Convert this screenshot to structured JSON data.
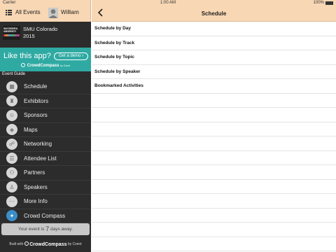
{
  "status_bar": {
    "carrier": "Carrier",
    "time": "1:00 AM",
    "battery": "100%"
  },
  "sidebar": {
    "all_events_label": "All Events",
    "username": "William",
    "event": {
      "logo_text": "SUCCESSFUL UNIVERSITY",
      "name_line1": "SMU Colorado",
      "name_line2": "2015"
    },
    "banner": {
      "headline": "Like this app?",
      "button": "Get a demo ›",
      "brand": "CrowdCompass",
      "brand_sub": "by Cvent"
    },
    "guide_label": "Event Guide",
    "items": [
      {
        "label": "Schedule",
        "icon": "calendar-icon"
      },
      {
        "label": "Exhibitors",
        "icon": "exhibitor-icon"
      },
      {
        "label": "Sponsors",
        "icon": "sponsor-icon"
      },
      {
        "label": "Maps",
        "icon": "map-icon"
      },
      {
        "label": "Networking",
        "icon": "networking-icon"
      },
      {
        "label": "Attendee List",
        "icon": "attendee-icon"
      },
      {
        "label": "Partners",
        "icon": "partners-icon"
      },
      {
        "label": "Speakers",
        "icon": "speaker-icon"
      },
      {
        "label": "More Info",
        "icon": "info-icon"
      },
      {
        "label": "Crowd Compass",
        "icon": "compass-icon"
      }
    ],
    "countdown": {
      "prefix": "Your event is",
      "days": "7",
      "suffix": "days away."
    },
    "built_with": {
      "prefix": "Built with",
      "brand": "CrowdCompass",
      "suffix": "by Cvent"
    }
  },
  "main": {
    "title": "Schedule",
    "rows": [
      "Schedule by Day",
      "Schedule by Track",
      "Schedule by Topic",
      "Schedule by Speaker",
      "Bookmarked Activities"
    ]
  }
}
